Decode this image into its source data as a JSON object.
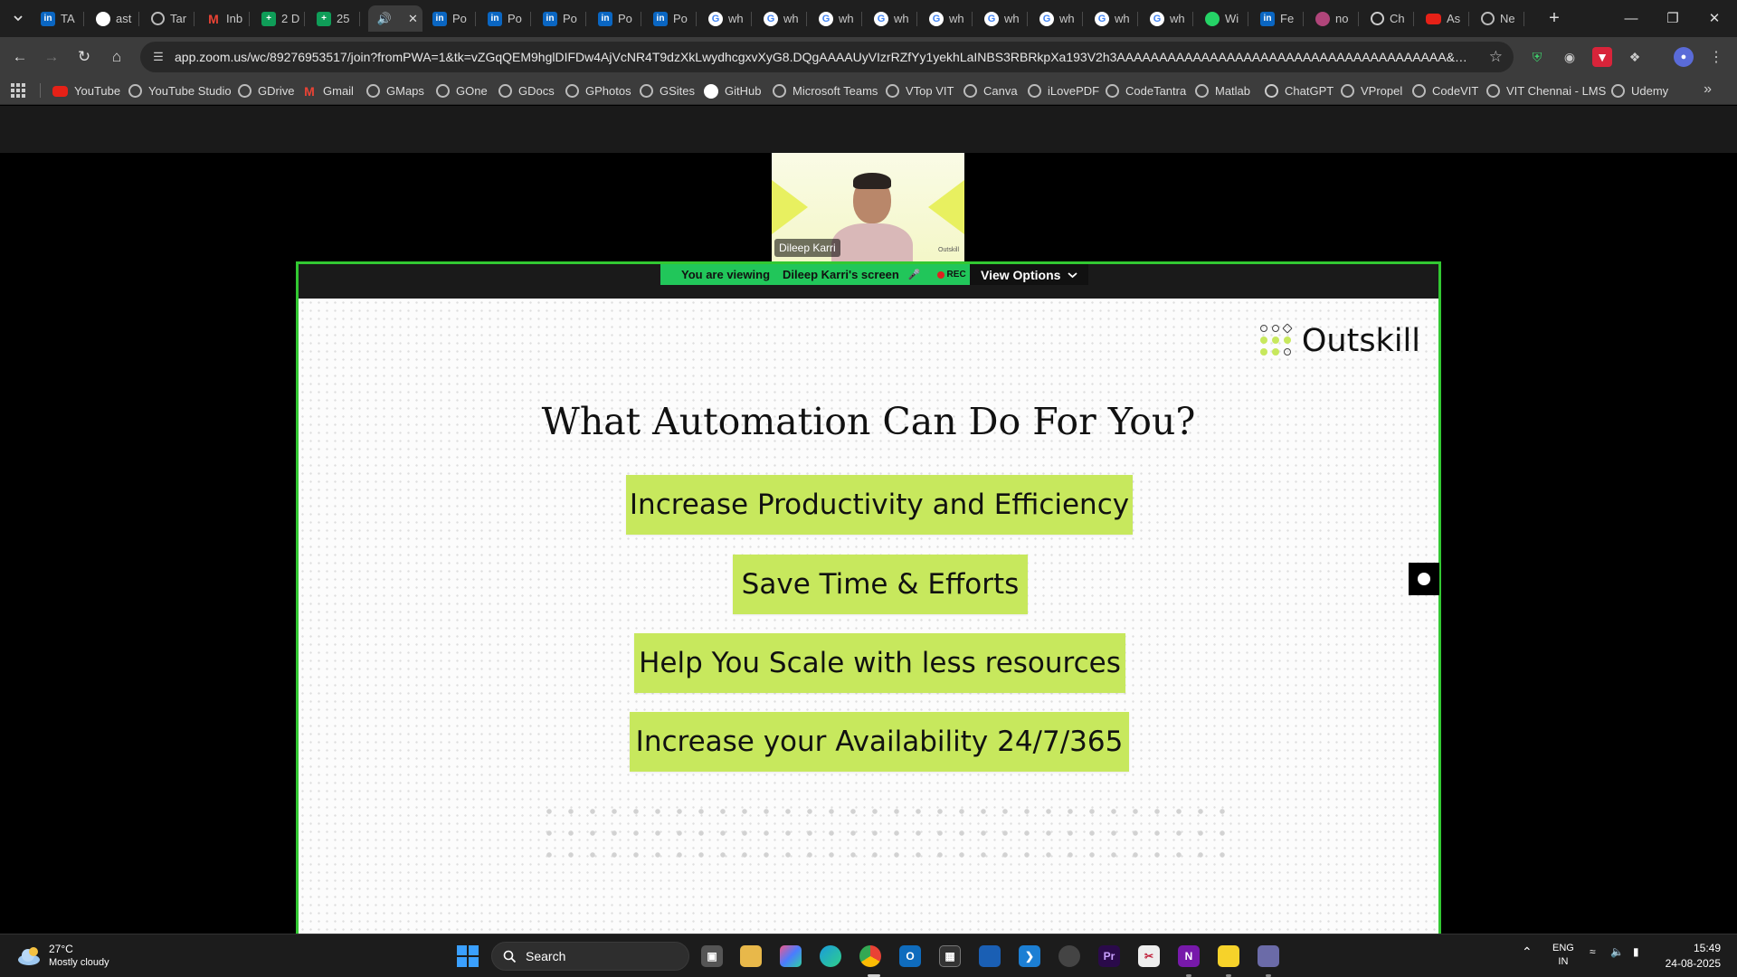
{
  "browser": {
    "tabs": [
      {
        "label": "TA",
        "icon": "linkedin"
      },
      {
        "label": "ast",
        "icon": "github"
      },
      {
        "label": "Tar",
        "icon": "globe"
      },
      {
        "label": "Inb",
        "icon": "gmail"
      },
      {
        "label": "2 D",
        "icon": "sheets"
      },
      {
        "label": "25",
        "icon": "sheets"
      },
      {
        "label": "",
        "icon": "speaker",
        "active": true
      },
      {
        "label": "Po",
        "icon": "linkedin"
      },
      {
        "label": "Po",
        "icon": "linkedin"
      },
      {
        "label": "Po",
        "icon": "linkedin"
      },
      {
        "label": "Po",
        "icon": "linkedin"
      },
      {
        "label": "Po",
        "icon": "linkedin"
      },
      {
        "label": "wh",
        "icon": "google"
      },
      {
        "label": "wh",
        "icon": "google"
      },
      {
        "label": "wh",
        "icon": "google"
      },
      {
        "label": "wh",
        "icon": "google"
      },
      {
        "label": "wh",
        "icon": "google"
      },
      {
        "label": "wh",
        "icon": "google"
      },
      {
        "label": "wh",
        "icon": "google"
      },
      {
        "label": "wh",
        "icon": "google"
      },
      {
        "label": "wh",
        "icon": "google"
      },
      {
        "label": "Wi",
        "icon": "whatsapp"
      },
      {
        "label": "Fe",
        "icon": "linkedin"
      },
      {
        "label": "no",
        "icon": "misc"
      },
      {
        "label": "Ch",
        "icon": "openai"
      },
      {
        "label": "As",
        "icon": "youtube"
      },
      {
        "label": "Ne",
        "icon": "globe"
      }
    ],
    "new_tab_glyph": "+",
    "url": "app.zoom.us/wc/89276953517/join?fromPWA=1&tk=vZGqQEM9hglDIFDw4AjVcNR4T9dzXkLwydhcgxvXyG8.DQgAAAAUyVIzrRZfYy1yekhLaINBS3RBRkpXa193V2h3AAAAAAAAAAAAAAAAAAAAAAAAAAAAAAAAAAAAAAA&_x_zm_r...",
    "bookmarks": [
      {
        "label": "YouTube",
        "icon": "youtube"
      },
      {
        "label": "YouTube Studio",
        "icon": "globe"
      },
      {
        "label": "GDrive",
        "icon": "globe"
      },
      {
        "label": "Gmail",
        "icon": "gmail"
      },
      {
        "label": "GMaps",
        "icon": "globe"
      },
      {
        "label": "GOne",
        "icon": "globe"
      },
      {
        "label": "GDocs",
        "icon": "globe"
      },
      {
        "label": "GPhotos",
        "icon": "globe"
      },
      {
        "label": "GSites",
        "icon": "globe"
      },
      {
        "label": "GitHub",
        "icon": "github"
      },
      {
        "label": "Microsoft Teams",
        "icon": "globe"
      },
      {
        "label": "VTop VIT",
        "icon": "globe"
      },
      {
        "label": "Canva",
        "icon": "globe"
      },
      {
        "label": "iLovePDF",
        "icon": "globe"
      },
      {
        "label": "CodeTantra",
        "icon": "globe"
      },
      {
        "label": "Matlab",
        "icon": "globe"
      },
      {
        "label": "ChatGPT",
        "icon": "openai"
      },
      {
        "label": "VPropel",
        "icon": "globe"
      },
      {
        "label": "CodeVIT",
        "icon": "globe"
      },
      {
        "label": "VIT Chennai - LMS",
        "icon": "globe"
      },
      {
        "label": "Udemy",
        "icon": "globe"
      }
    ]
  },
  "zoom": {
    "participant_name": "Dileep Karri",
    "video_watermark": "Outskill",
    "viewing_prefix": "You are viewing",
    "viewing_subject": "Dileep Karri's screen",
    "rec_label": "REC",
    "view_options_label": "View Options",
    "share_border_color": "#32c832"
  },
  "slide": {
    "brand": "Outskill",
    "title": "What Automation Can Do For You?",
    "items": [
      "Increase Productivity and Efficiency",
      "Save Time & Efforts",
      "Help You Scale with less resources",
      "Increase your Availability 24/7/365"
    ],
    "accent_color": "#c7e85d"
  },
  "taskbar": {
    "temperature": "27°C",
    "weather": "Mostly cloudy",
    "search_placeholder": "Search",
    "lang_top": "ENG",
    "lang_bottom": "IN",
    "time": "15:49",
    "date": "24-08-2025"
  }
}
